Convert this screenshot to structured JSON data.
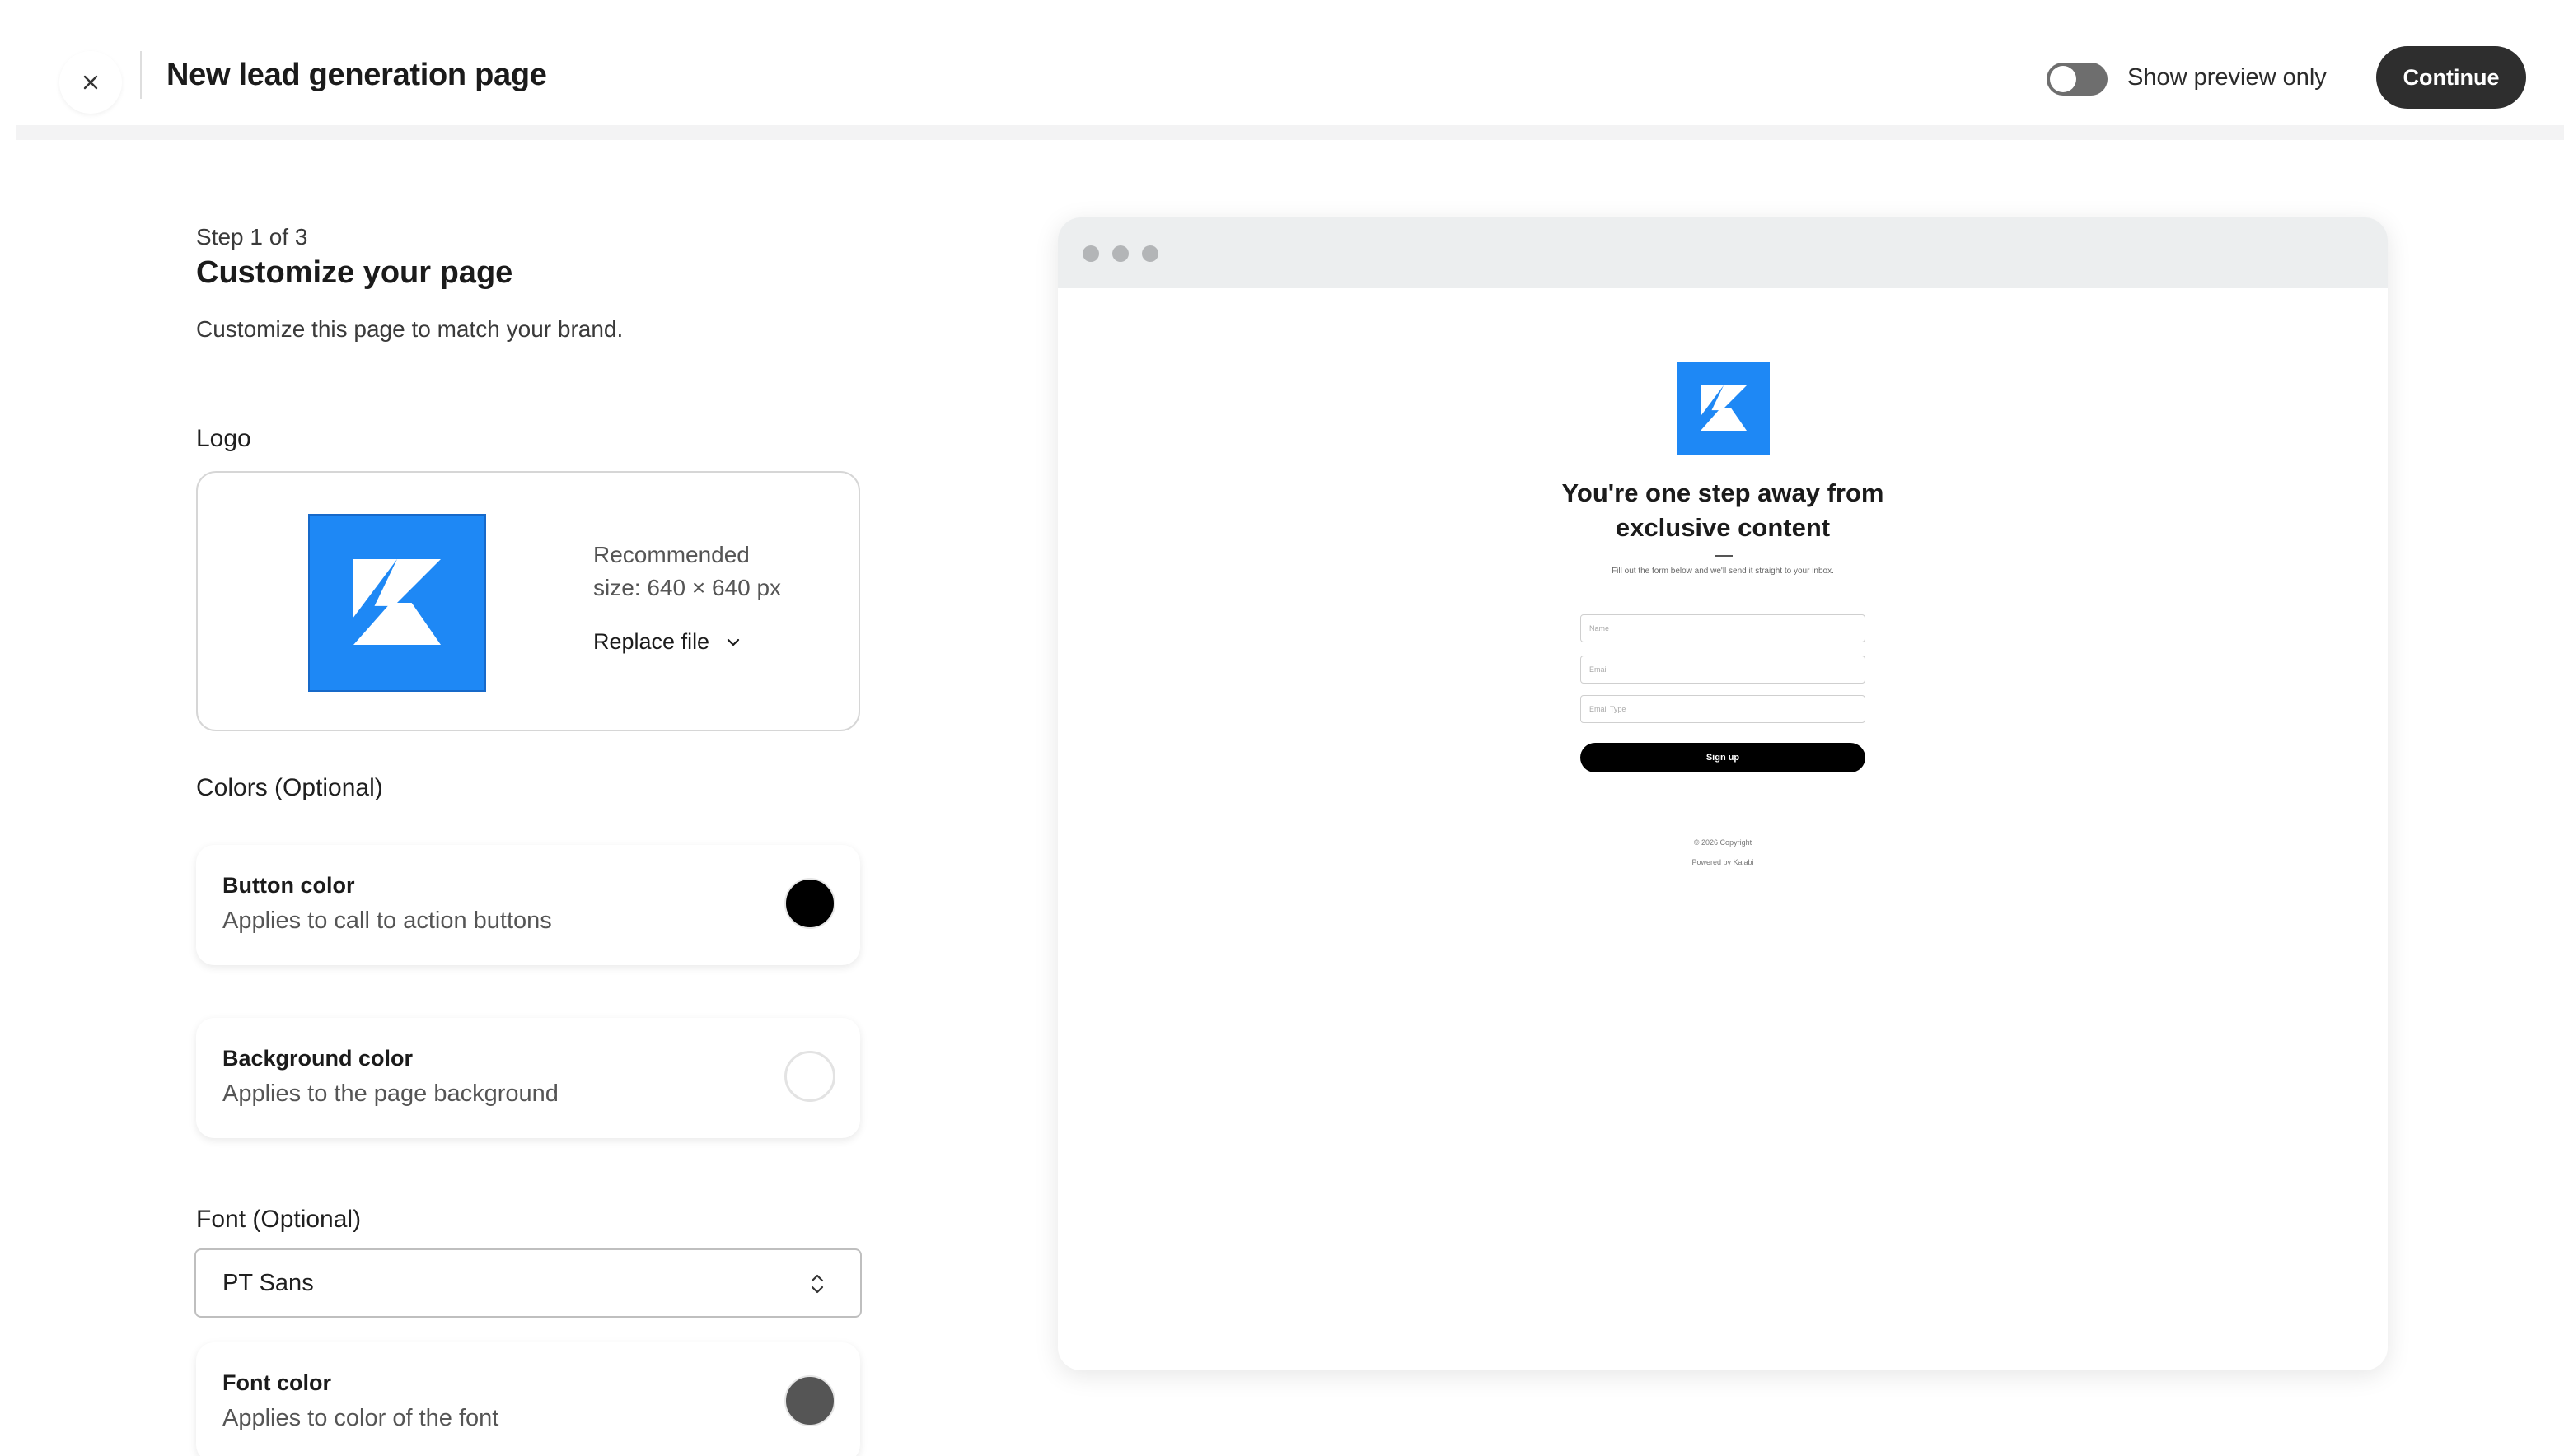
{
  "header": {
    "title": "New lead generation page",
    "toggle_label": "Show preview only",
    "toggle_on": false,
    "continue_label": "Continue"
  },
  "intro": {
    "step": "Step 1 of 3",
    "title": "Customize your page",
    "subtitle": "Customize this page to match your brand."
  },
  "logo": {
    "label": "Logo",
    "recommended_line1": "Recommended",
    "recommended_line2": "size: 640 × 640 px",
    "replace_label": "Replace file"
  },
  "colors": {
    "label": "Colors (Optional)",
    "button": {
      "title": "Button color",
      "desc": "Applies to call to action buttons",
      "color": "#000000"
    },
    "background": {
      "title": "Background color",
      "desc": "Applies to the page background",
      "color": "#ffffff"
    }
  },
  "font": {
    "label": "Font (Optional)",
    "selected": "PT Sans",
    "color_card": {
      "title": "Font color",
      "desc": "Applies to color of the font",
      "color": "#555555"
    }
  },
  "preview": {
    "heading": "You're one step away from exclusive content",
    "subtext": "Fill out the form below and we'll send it straight to your inbox.",
    "fields": [
      "Name",
      "Email",
      "Email Type"
    ],
    "button_label": "Sign up",
    "copyright": "© 2026 Copyright",
    "powered_by": "Powered by Kajabi"
  },
  "theme": {
    "brand_blue": "#1e88f5",
    "dark_button": "#2e2e2e"
  }
}
